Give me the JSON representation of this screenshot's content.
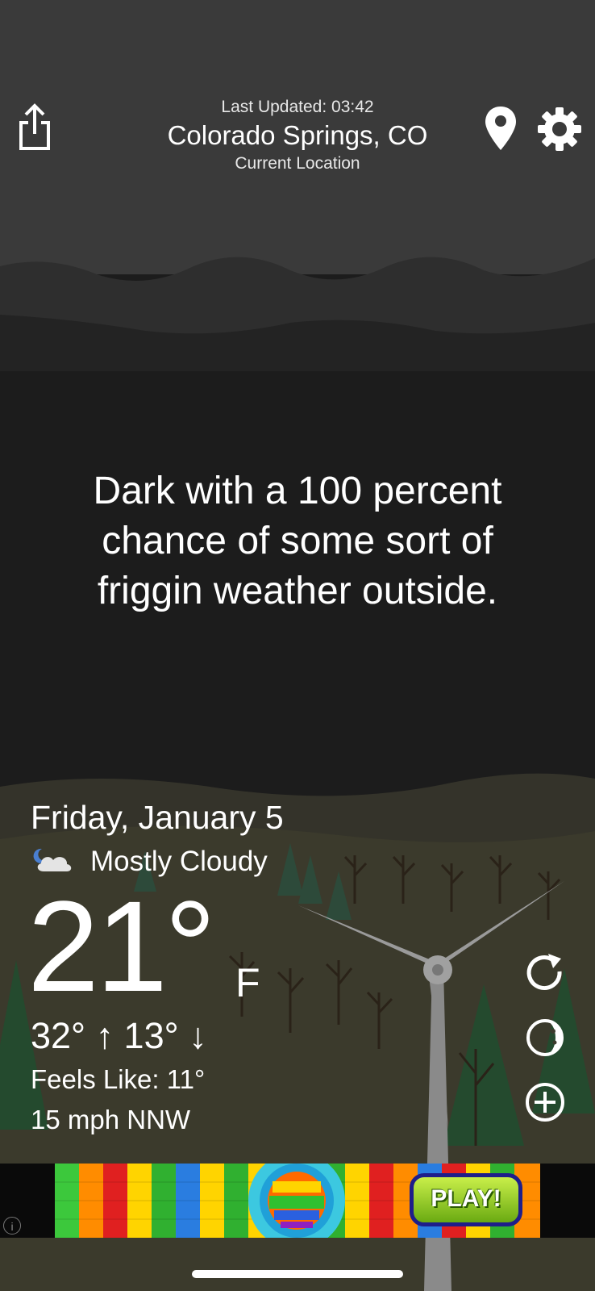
{
  "header": {
    "last_updated": "Last Updated: 03:42",
    "city": "Colorado Springs, CO",
    "location_label": "Current Location",
    "icons": [
      "share-icon",
      "location-pin-icon",
      "gear-icon"
    ]
  },
  "quip": {
    "line1": "Dark with a 100 percent",
    "line2": "chance of some sort of",
    "line3": "friggin weather outside."
  },
  "weather": {
    "date": "Friday, January 5",
    "condition": "Mostly Cloudy",
    "condition_icon": "mostly-cloudy-night-icon",
    "temperature": "21°",
    "unit": "F",
    "high_low": "32° ↑  13° ↓",
    "feels_like": "Feels Like: 11°",
    "wind": "15 mph NNW"
  },
  "side_actions": [
    "refresh-icon",
    "moon-phase-icon",
    "add-icon"
  ],
  "ad": {
    "button_label": "PLAY!",
    "info_label": "i"
  },
  "colors": {
    "sky_top": "#3a3a3a",
    "sky_dark": "#1c1c1c",
    "hill": "#3b3a2c",
    "text": "#ffffff"
  }
}
